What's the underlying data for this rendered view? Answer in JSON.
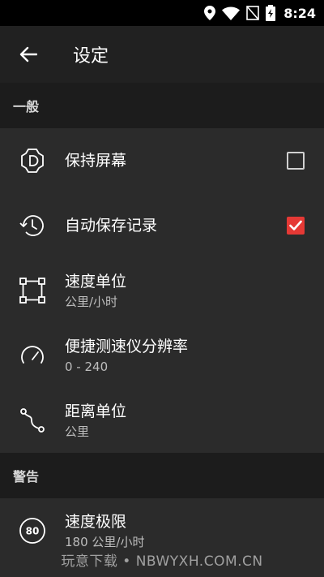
{
  "status_bar": {
    "time": "8:24"
  },
  "app_bar": {
    "title": "设定"
  },
  "sections": [
    {
      "header": "一般",
      "items": [
        {
          "title": "保持屏幕",
          "subtitle": "",
          "icon": "screen-brightness-icon",
          "checkbox": "unchecked"
        },
        {
          "title": "自动保存记录",
          "subtitle": "",
          "icon": "history-icon",
          "checkbox": "checked"
        },
        {
          "title": "速度单位",
          "subtitle": "公里/小时",
          "icon": "vector-square-icon"
        },
        {
          "title": "便捷测速仪分辨率",
          "subtitle": "0 - 240",
          "icon": "speedometer-icon"
        },
        {
          "title": "距离单位",
          "subtitle": "公里",
          "icon": "route-icon"
        }
      ]
    },
    {
      "header": "警告",
      "items": [
        {
          "title": "速度极限",
          "subtitle": "180 公里/小时",
          "icon": "speed-limit-80-icon",
          "badge": "80"
        }
      ]
    }
  ],
  "watermark": "玩意下载 • NBWYXH.COM.CN",
  "colors": {
    "accent": "#e53935",
    "background": "#2b2b2b",
    "header_bg": "#1c1c1c",
    "appbar_bg": "#212121"
  }
}
